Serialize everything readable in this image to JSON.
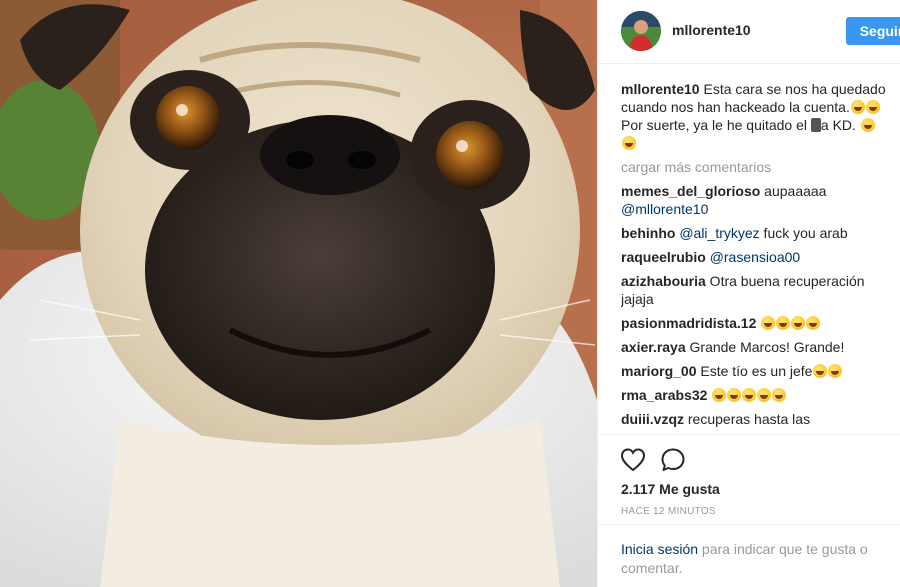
{
  "post": {
    "username": "mllorente10",
    "follow_label": "Seguir",
    "caption": {
      "username": "mllorente10",
      "text_1": " Esta cara se nos ha quedado cuando nos han hackeado la cuenta.",
      "text_2": " Por suerte, ya le he quitado el ",
      "text_3": "a KD. "
    },
    "load_more": "cargar más comentarios",
    "comments": [
      {
        "user": "memes_del_glorioso",
        "text": " aupaaaaa ",
        "mention": "@mllorente10",
        "after": ""
      },
      {
        "user": "behinho",
        "text": " ",
        "mention": "@ali_trykyez",
        "after": " fuck you arab"
      },
      {
        "user": "raqueelrubio",
        "text": " ",
        "mention": "@rasensioa00",
        "after": ""
      },
      {
        "user": "azizhabouria",
        "text": " Otra buena recuperación jajaja",
        "mention": "",
        "after": ""
      },
      {
        "user": "pasionmadridista.12",
        "text": " ",
        "mention": "",
        "after": ""
      },
      {
        "user": "axier.raya",
        "text": " Grande Marcos! Grande!",
        "mention": "",
        "after": ""
      },
      {
        "user": "mariorg_00",
        "text": " Este tío es un jefe",
        "mention": "",
        "after": ""
      },
      {
        "user": "rma_arabs32",
        "text": " ",
        "mention": "",
        "after": ""
      },
      {
        "user": "duiii.vzqz",
        "text": " recuperas hasta las",
        "mention": "",
        "after": ""
      }
    ],
    "likes": "2.117 Me gusta",
    "time": "HACE 12 MINUTOS",
    "login": {
      "link": "Inicia sesión",
      "text": " para indicar que te gusta o comentar."
    }
  },
  "icons": {
    "heart": "heart-icon",
    "comment": "comment-icon",
    "emoji": "laughing-emoji-icon",
    "phone": "mobile-phone-icon"
  },
  "colors": {
    "follow_button": "#3897f0",
    "mention": "#003569",
    "muted": "#999999",
    "divider": "#efefef"
  }
}
